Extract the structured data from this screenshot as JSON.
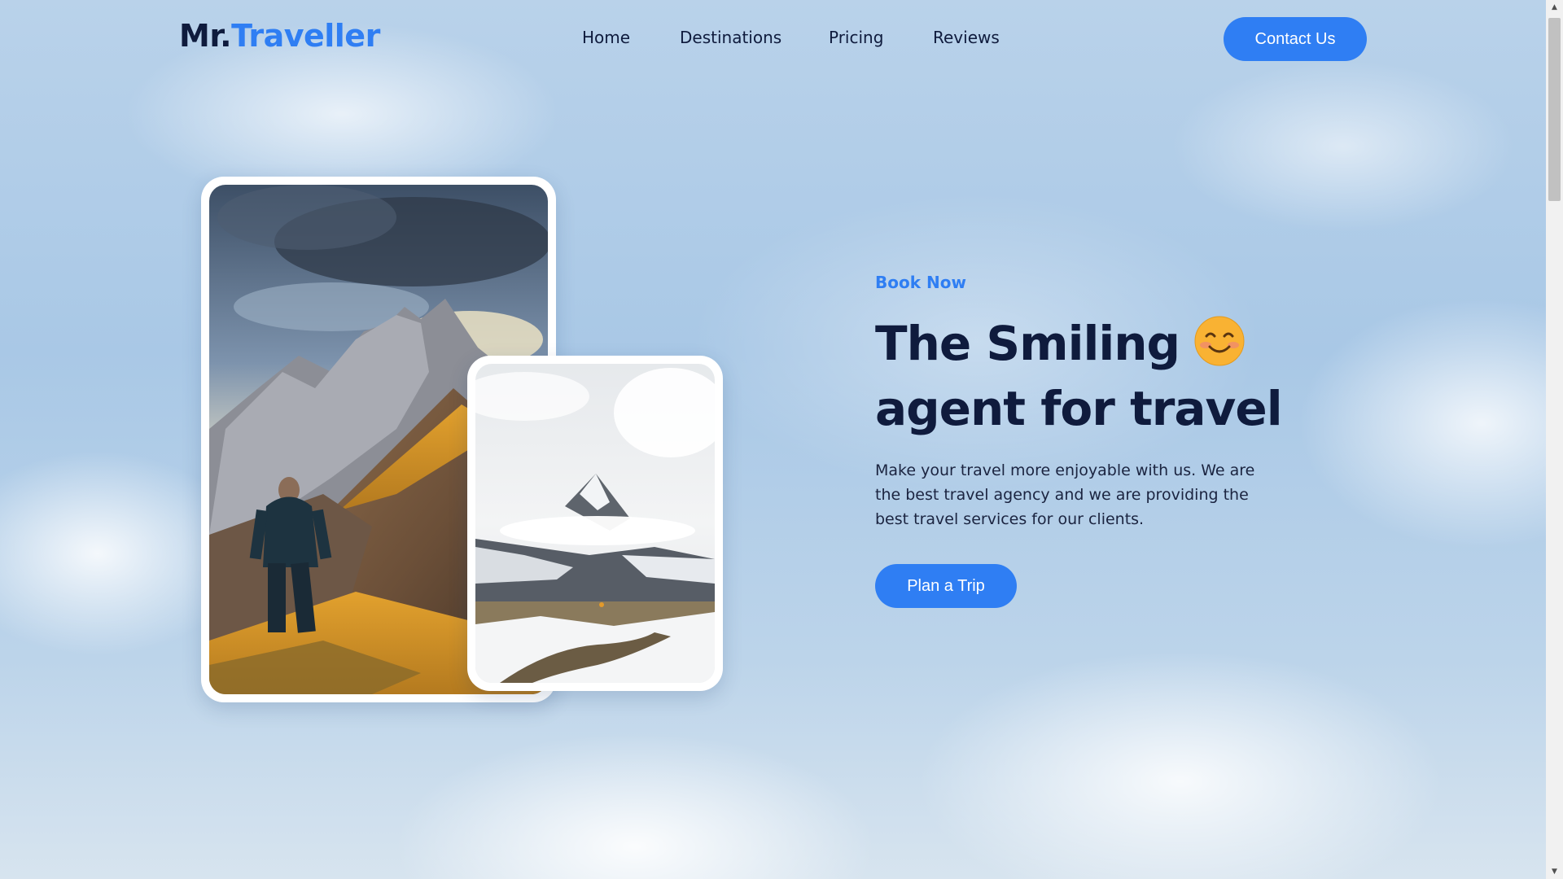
{
  "header": {
    "logo_prefix": "Mr.",
    "logo_accent": "Traveller",
    "nav": [
      {
        "label": "Home"
      },
      {
        "label": "Destinations"
      },
      {
        "label": "Pricing"
      },
      {
        "label": "Reviews"
      }
    ],
    "contact_label": "Contact Us"
  },
  "hero": {
    "eyebrow": "Book Now",
    "headline_line1": "The Smiling",
    "headline_line2": "agent for travel",
    "emoji_icon": "smiling-face-emoji",
    "description": "Make your travel more enjoyable with us. We are the best travel agency and we are providing the best travel services for our clients.",
    "cta_label": "Plan a Trip"
  },
  "images": {
    "main": "hiker-on-mountain-ridge-photo",
    "secondary": "snowy-mountain-peak-photo"
  },
  "colors": {
    "accent": "#2f7ef3",
    "heading": "#0f1b3d",
    "background": "#b9d2ea"
  },
  "scrollbar": {
    "up_icon": "scroll-up-arrow-icon",
    "down_icon": "scroll-down-arrow-icon"
  }
}
